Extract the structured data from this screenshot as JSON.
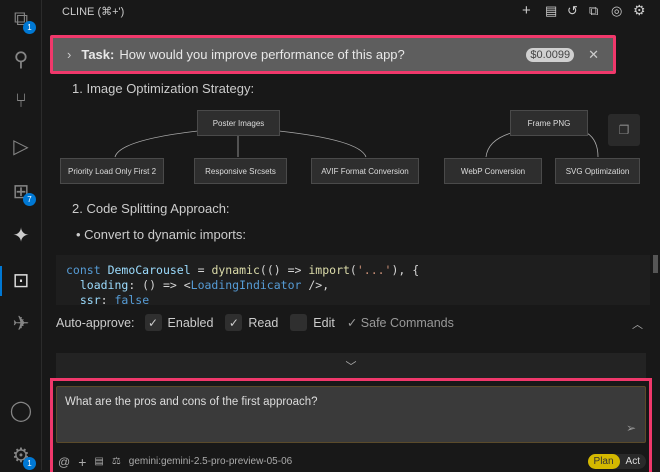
{
  "header": {
    "title": "CLINE (⌘+')",
    "icons": [
      "plus-icon",
      "server-icon",
      "history-icon",
      "popout-icon",
      "account-icon",
      "gear-icon"
    ]
  },
  "activity": {
    "explorer_badge": "1",
    "extensions_badge": "7",
    "settings_badge": "1"
  },
  "task": {
    "label": "Task:",
    "text": "How would you improve performance of this app?",
    "cost": "$0.0099"
  },
  "content": {
    "heading1": "1. Image Optimization Strategy:",
    "diagram": {
      "roots": [
        "Poster Images",
        "Frame PNG"
      ],
      "children": [
        "Priority Load Only First 2",
        "Responsive Srcsets",
        "AVIF Format Conversion",
        "WebP Conversion",
        "SVG Optimization"
      ]
    },
    "heading2": "2. Code Splitting Approach:",
    "bullet": "Convert to dynamic imports:"
  },
  "auto_approve": {
    "label": "Auto-approve:",
    "items": [
      {
        "label": "Enabled",
        "checked": true
      },
      {
        "label": "Read",
        "checked": true
      },
      {
        "label": "Edit",
        "checked": false
      }
    ],
    "safe": "✓ Safe Commands"
  },
  "input": {
    "value": "What are the pros and cons of the first approach?"
  },
  "footer": {
    "model": "gemini:gemini-2.5-pro-preview-05-06",
    "plan": "Plan",
    "act": "Act",
    "active_mode": "Plan"
  },
  "colors": {
    "highlight": "#f0386b",
    "accent": "#0078d4",
    "plan": "#d4b800"
  }
}
